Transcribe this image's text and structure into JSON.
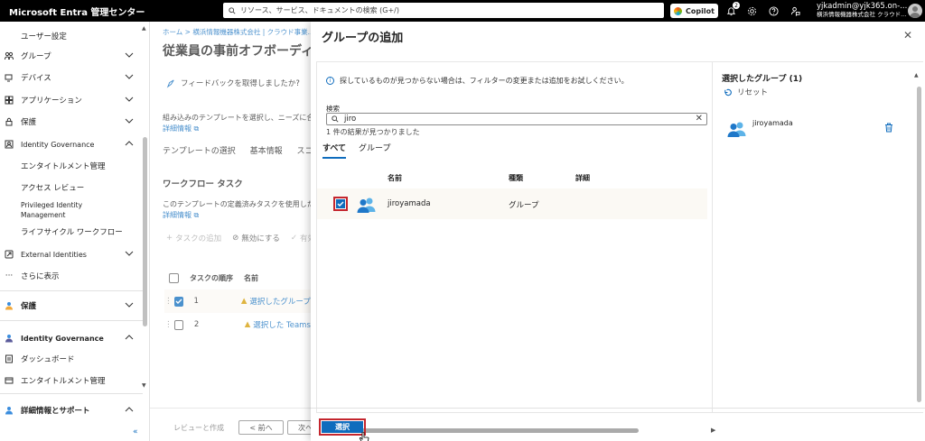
{
  "header": {
    "brand": "Microsoft Entra 管理センター",
    "search_placeholder": "リソース、サービス、ドキュメントの検索 (G+/)",
    "copilot_label": "Copilot",
    "notification_count": "2",
    "account_user": "yjkadmin@yjk365.on-...",
    "account_org": "横浜情報機器株式会社 クラウド..."
  },
  "sidebar": {
    "items": [
      {
        "label": "ユーザー設定",
        "icon": "none"
      },
      {
        "label": "グループ",
        "icon": "group-icon"
      },
      {
        "label": "デバイス",
        "icon": "device-icon"
      },
      {
        "label": "アプリケーション",
        "icon": "app-icon"
      },
      {
        "label": "保護",
        "icon": "lock-icon"
      },
      {
        "label": "Identity Governance",
        "icon": "governance-icon"
      },
      {
        "label": "エンタイトルメント管理",
        "icon": "none"
      },
      {
        "label": "アクセス レビュー",
        "icon": "none"
      },
      {
        "label": "Privileged Identity Management",
        "icon": "none"
      },
      {
        "label": "ライフサイクル ワークフロー",
        "icon": "none"
      },
      {
        "label": "External Identities",
        "icon": "external-icon"
      },
      {
        "label": "さらに表示",
        "icon": "more-icon"
      }
    ],
    "section_protect": "保護",
    "section_governance": "Identity Governance",
    "dashboard": "ダッシュボード",
    "entitlement": "エンタイトルメント管理",
    "support": "詳細情報とサポート",
    "collapse": "«"
  },
  "main": {
    "breadcrumb": "ホーム > 横浜情報機器株式会社 | クラウド事業...",
    "title": "従業員の事前オフボーディング",
    "feedback": "フィードバックを取得しましたか?",
    "desc1": "組み込みのテンプレートを選択し、ニーズに合...",
    "link1": "詳細情報",
    "tabs": [
      "テンプレートの選択",
      "基本情報",
      "スコー"
    ],
    "section_title": "ワークフロー タスク",
    "desc2": "このテンプレートの定義済みタスクを使用した...",
    "link2": "詳細情報",
    "toolbar": {
      "add": "タスクの追加",
      "disable": "無効にする",
      "enable": "有効"
    },
    "columns": {
      "order": "タスクの順序",
      "name": "名前"
    },
    "rows": [
      {
        "order": "1",
        "name": "選択したグループ..."
      },
      {
        "order": "2",
        "name": "選択した Teams..."
      }
    ],
    "footer": {
      "review": "レビューと作成",
      "prev": "< 前へ",
      "next": "次へ"
    }
  },
  "panel": {
    "title": "グループの追加",
    "info": "探しているものが見つからない場合は、フィルターの変更または追加をお試しください。",
    "search_label": "検索",
    "search_value": "jiro",
    "result_count": "1 件の結果が見つかりました",
    "filter_tabs": [
      "すべて",
      "グループ"
    ],
    "columns": {
      "name": "名前",
      "type": "種類",
      "detail": "詳細"
    },
    "rows": [
      {
        "name": "jiroyamada",
        "type": "グループ"
      }
    ],
    "selected_title": "選択したグループ (1)",
    "reset": "リセット",
    "selected_items": [
      {
        "name": "jiroyamada"
      }
    ],
    "select_button": "選択"
  },
  "colors": {
    "accent": "#0f6cbd",
    "highlight": "#c4262e",
    "warning": "#d49b00"
  }
}
